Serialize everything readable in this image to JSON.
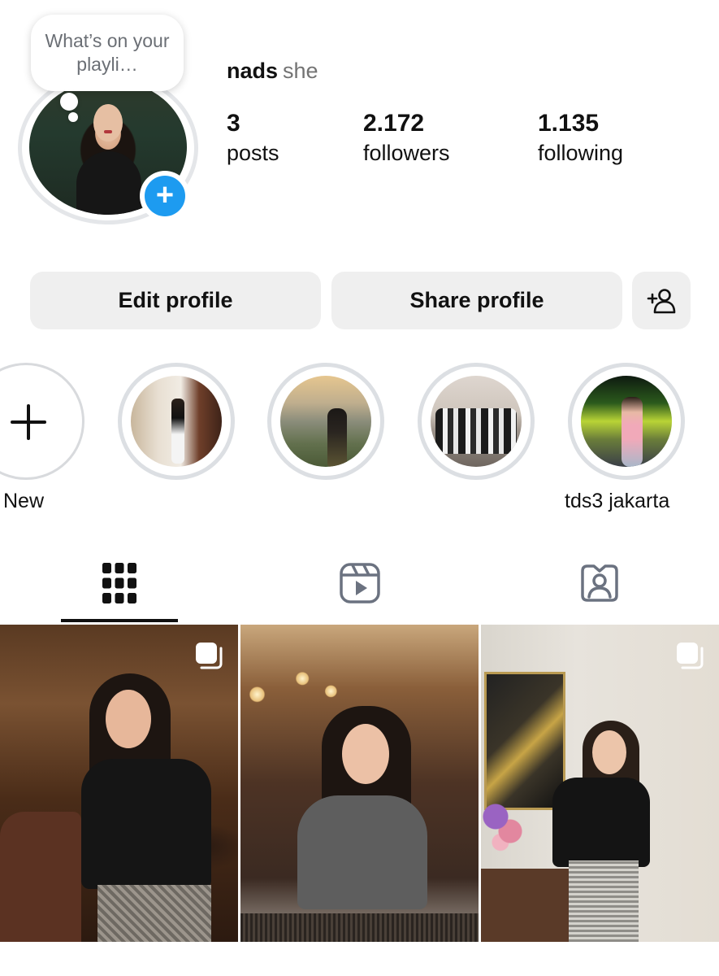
{
  "profile": {
    "note": "What’s on your playli…",
    "username": "nads",
    "pronouns": "she"
  },
  "stats": {
    "posts": {
      "value": "3",
      "label": "posts"
    },
    "followers": {
      "value": "2.172",
      "label": "followers"
    },
    "following": {
      "value": "1.135",
      "label": "following"
    }
  },
  "actions": {
    "edit_label": "Edit profile",
    "share_label": "Share profile",
    "discover_people_icon": "add-person-icon"
  },
  "highlights": [
    {
      "label": "New"
    },
    {
      "label": ""
    },
    {
      "label": ""
    },
    {
      "label": ""
    },
    {
      "label": "tds3 jakarta"
    }
  ],
  "tabs": [
    {
      "icon": "grid-icon",
      "active": true
    },
    {
      "icon": "reels-icon",
      "active": false
    },
    {
      "icon": "tagged-icon",
      "active": false
    }
  ],
  "posts": [
    {
      "type": "carousel"
    },
    {
      "type": "single"
    },
    {
      "type": "carousel"
    }
  ],
  "colors": {
    "accent": "#1d9bf0",
    "button_bg": "#efefef",
    "muted_text": "#737373"
  }
}
